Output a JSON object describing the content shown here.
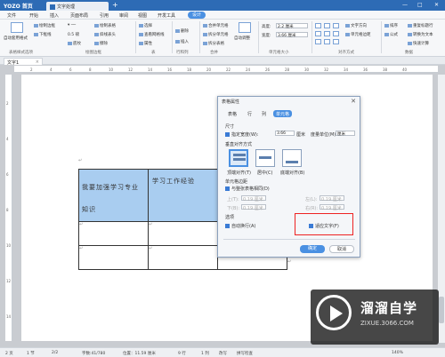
{
  "titlebar": {
    "brand": "YOZO 首页",
    "doc_tab": "文字处理",
    "plus": "+",
    "minimize": "—",
    "maximize": "□",
    "close": "✕"
  },
  "menu": [
    "文件",
    "开始",
    "插入",
    "页面布局",
    "引用",
    "审阅",
    "视图",
    "开发工具",
    "设计"
  ],
  "ribbon": {
    "auto_format": "自动套用格式",
    "draw_border": "绘制边框",
    "bottom_border": "下框线",
    "border_width": "0.5 磅",
    "line_style": "斜线表头",
    "shading": "底纹",
    "draw_table": "绘制表格",
    "eraser": "擦除",
    "select": "选择",
    "gridlines": "查看网格线",
    "properties": "属性",
    "delete": "删除",
    "insert": "插入",
    "merge": "合并单元格",
    "split_cells": "拆分单元格",
    "split_table": "拆分表格",
    "auto_fit": "自动调整",
    "height_label": "高度:",
    "height_val": "2.2 厘米",
    "width_label": "宽度:",
    "width_val": "3.66 厘米",
    "text_dir": "文字方向",
    "cell_margin": "单元格边距",
    "sort": "排序",
    "formula": "公式",
    "repeat_header": "重复标题行",
    "convert": "转换为文本",
    "quick_calc": "快速计算",
    "groups": [
      "表格样式选项",
      "绘图边框",
      "表",
      "行和列",
      "合并",
      "单元格大小",
      "对齐方式",
      "数据"
    ]
  },
  "doc_tab": "文字1",
  "ruler_ticks": [
    "2",
    "4",
    "6",
    "8",
    "10",
    "12",
    "14",
    "16",
    "18",
    "20",
    "22",
    "24",
    "26",
    "28",
    "30",
    "32",
    "34",
    "36",
    "38",
    "40"
  ],
  "vruler_ticks": [
    "2",
    "4",
    "6",
    "8",
    "10",
    "12",
    "14"
  ],
  "document": {
    "cell1": "我要加强学习专业知识",
    "cell2": "学习工作经验",
    "mark": "↵"
  },
  "dialog": {
    "title": "表格属性",
    "close": "✕",
    "tabs": [
      "表格",
      "行",
      "列",
      "单元格"
    ],
    "active_tab": 3,
    "size_section": "尺寸",
    "pref_width": "指定宽度(W):",
    "pref_width_val": "3.66",
    "pref_width_unit": "厘米",
    "measure_in": "度量单位(M):",
    "measure_unit": "厘米",
    "valign_section": "垂直对齐方式",
    "align_top": "顶端对齐(T)",
    "align_center": "居中(C)",
    "align_bottom": "底端对齐(B)",
    "margin_section": "单元格边距",
    "same_as_table": "与整张表格相同(D)",
    "top_label": "上(T):",
    "top_val": "0.19 厘米",
    "left_label": "左(L):",
    "left_val": "0.19 厘米",
    "bottom_label": "下(B):",
    "bottom_val": "0.19 厘米",
    "right_label": "右(R):",
    "right_val": "0.19 厘米",
    "options_section": "选项",
    "wrap_text": "自动换行(A)",
    "fit_text": "适应文字(F)",
    "ok": "确定",
    "cancel": "取消"
  },
  "status": {
    "page": "2 页",
    "section": "1 节",
    "pages": "2/2",
    "words": "字数:41/780",
    "position": "位置：11.59 厘米",
    "line": "9 行",
    "col": "1 列",
    "overwrite": "改写",
    "spellcheck": "拼写检查",
    "zoom": "140%"
  },
  "watermark": {
    "brand": "溜溜自学",
    "url": "ZIXUE.3066.COM"
  }
}
